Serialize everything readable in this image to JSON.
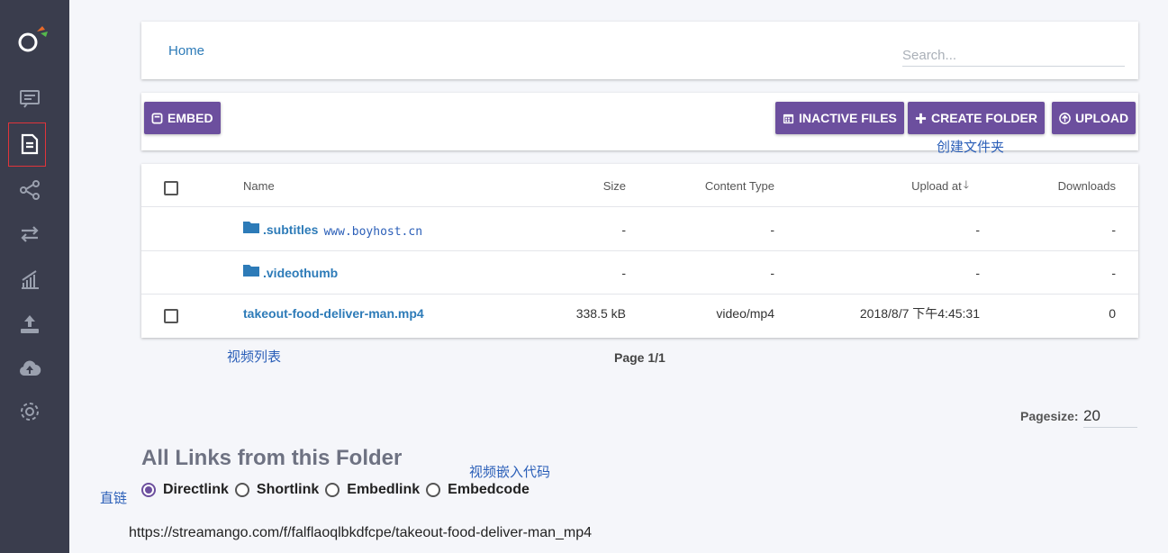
{
  "header": {
    "home_label": "Home",
    "search_placeholder": "Search..."
  },
  "toolbar": {
    "embed_label": "EMBED",
    "inactive_files_label": "INACTIVE FILES",
    "create_folder_label": "CREATE FOLDER",
    "upload_label": "UPLOAD"
  },
  "table": {
    "columns": [
      "Name",
      "Size",
      "Content Type",
      "Upload at",
      "Downloads"
    ],
    "sort_indicator": "🡓",
    "rows": [
      {
        "name": ".subtitles",
        "size": "-",
        "type": "-",
        "upload": "-",
        "downloads": "-"
      },
      {
        "name": ".videothumb",
        "size": "-",
        "type": "-",
        "upload": "-",
        "downloads": "-"
      },
      {
        "name": "takeout-food-deliver-man.mp4",
        "size": "338.5 kB",
        "type": "video/mp4",
        "upload": "2018/8/7 下午4:45:31",
        "downloads": "0"
      }
    ]
  },
  "pagination": {
    "page_info": "Page 1/1",
    "pagesize_label": "Pagesize:",
    "pagesize_value": "20"
  },
  "links": {
    "title": "All Links from this Folder",
    "options": [
      "Directlink",
      "Shortlink",
      "Embedlink",
      "Embedcode"
    ],
    "selected": "Directlink",
    "url": "https://streamango.com/f/falflaoqlbkdfcpe/takeout-food-deliver-man_mp4"
  },
  "annotations": {
    "create_folder": "创建文件夹",
    "watermark": "www.boyhost.cn",
    "video_list": "视频列表",
    "embed_code": "视频嵌入代码",
    "direct_link": "直链"
  },
  "colors": {
    "sidebar": "#3a3d4d",
    "accent": "#6c4f9e",
    "link": "#2d7bb8",
    "annotation": "#2b5fb8"
  }
}
